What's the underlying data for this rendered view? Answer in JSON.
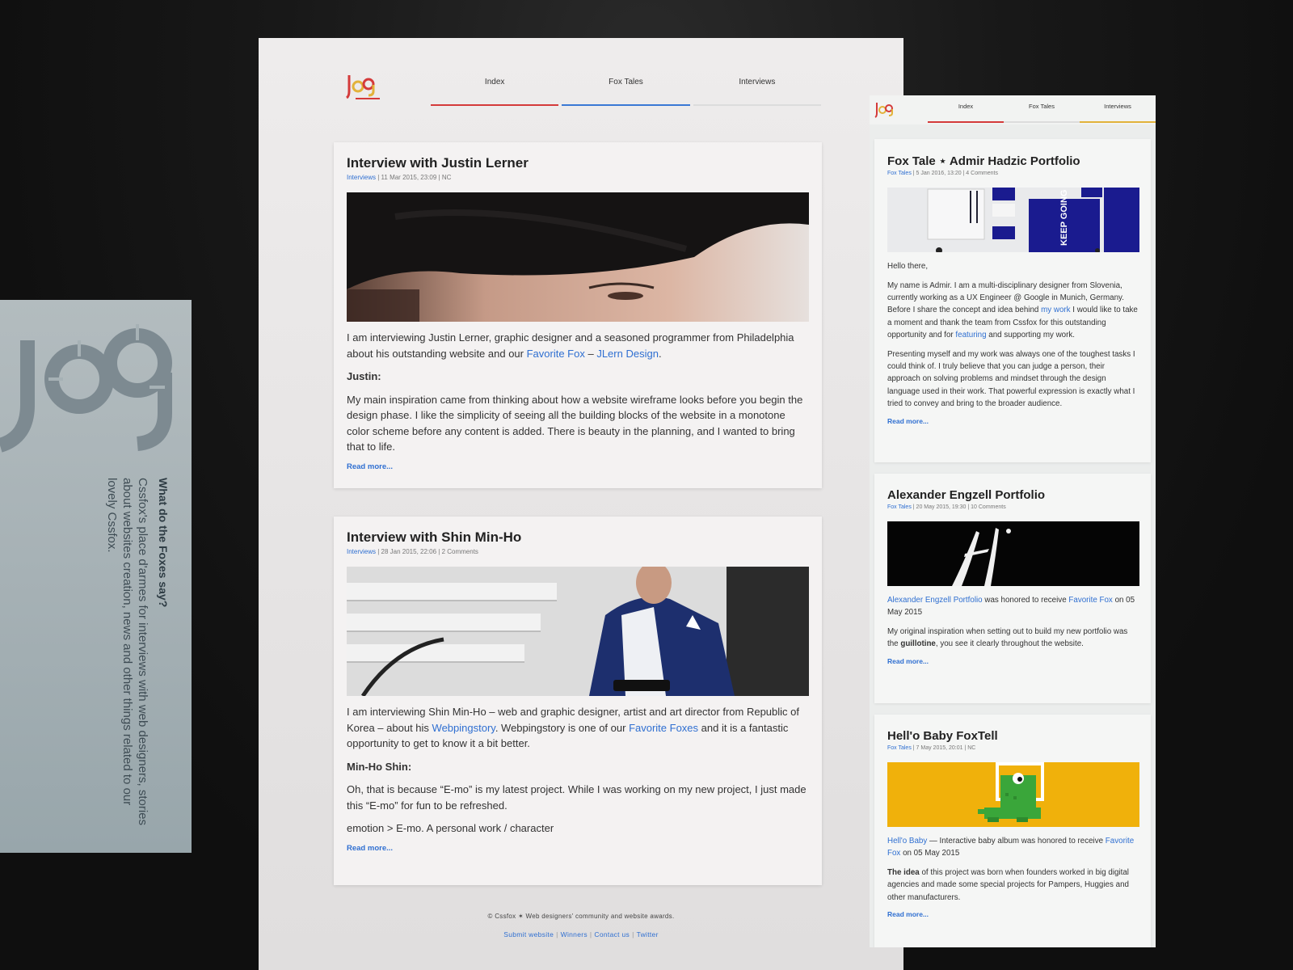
{
  "colors": {
    "accent_blue": "#2f6fd1",
    "nav_red": "#d43a3a",
    "nav_blue": "#3a78d4",
    "nav_yellow": "#e2b23a",
    "background": "#121212"
  },
  "side_panel": {
    "heading": "What do the Foxes say?",
    "text": "Cssfox's place d'armes for interviews with web designers, stories about websites creation, news and other things related to our lovely Cssfox."
  },
  "main": {
    "nav": [
      "Index",
      "Fox Tales",
      "Interviews"
    ],
    "posts": [
      {
        "title": "Interview with Justin Lerner",
        "category": "Interviews",
        "meta": " | 11 Mar 2015, 23:09 | NC",
        "intro_pre": "I am interviewing Justin Lerner, graphic designer and a seasoned programmer from Philadelphia about his outstanding website and our ",
        "link1": "Favorite Fox",
        "dash": " – ",
        "link2": "JLern Design",
        "intro_post": ".",
        "label": "Justin:",
        "body": "My main inspiration came from thinking about how a website wireframe looks before you begin the design phase. I like the simplicity of seeing all the building blocks of the website in a monotone color scheme before any content is added. There is beauty in the planning, and I wanted to bring that to life.",
        "read_more": "Read more..."
      },
      {
        "title": "Interview with Shin Min-Ho",
        "category": "Interviews",
        "meta": " | 28 Jan 2015, 22:06 | 2 Comments",
        "intro_pre": "I am interviewing Shin Min-Ho – web and graphic designer, artist and art director from Republic of Korea – about his ",
        "link1": "Webpingstory",
        "intro_mid": ". Webpingstory is one of our ",
        "link2": "Favorite Foxes",
        "intro_post": " and it is a fantastic opportunity to get to know it a bit better.",
        "label": "Min-Ho Shin:",
        "body": "Oh, that is because “E-mo” is my latest project. While I was working on my new project, I just made this “E-mo” for fun to be refreshed.",
        "body2": "emotion > E-mo. A personal work / character",
        "read_more": "Read more..."
      }
    ],
    "footer": {
      "copyright": "© Cssfox ✶ Web designers' community and website awards.",
      "links": [
        "Submit website",
        "Winners",
        "Contact us",
        "Twitter"
      ]
    }
  },
  "right": {
    "nav": [
      "Index",
      "Fox Tales",
      "Interviews"
    ],
    "posts": [
      {
        "title": "Fox Tale ⋆ Admir Hadzic Portfolio",
        "category": "Fox Tales",
        "meta": " | 5 Jan 2016, 13:20 | 4 Comments",
        "greeting": "Hello there,",
        "p1_pre": "My name is Admir. I am a multi-disciplinary designer from Slovenia, currently working as a UX Engineer @ Google in Munich, Germany. Before I share the concept and idea behind ",
        "p1_link1": "my work",
        "p1_mid": " I would like to take a moment and thank the team from Cssfox for this outstanding opportunity and for ",
        "p1_link2": "featuring",
        "p1_post": " and supporting my work.",
        "p2": "Presenting myself and my work was always one of the toughest tasks I could think of. I truly believe that you can judge a person, their approach on solving problems and mindset through the design language used in their work. That powerful expression is exactly what I tried to convey and bring to the broader audience.",
        "img_text": "KEEP GOING",
        "read_more": "Read more..."
      },
      {
        "title": "Alexander Engzell Portfolio",
        "category": "Fox Tales",
        "meta": " | 20 May 2015, 19:30 | 10 Comments",
        "p1_link1": "Alexander Engzell Portfolio",
        "p1_mid": " was honored to receive ",
        "p1_link2": "Favorite Fox",
        "p1_post": " on 05 May 2015",
        "p2_pre": "My original inspiration when setting out to build my new portfolio was the ",
        "p2_bold": "guillotine",
        "p2_post": ", you see it clearly throughout the website.",
        "read_more": "Read more..."
      },
      {
        "title": "Hell'o Baby FoxTell",
        "category": "Fox Tales",
        "meta": " | 7 May 2015, 20:01 | NC",
        "p1_link1": "Hell'o Baby",
        "p1_mid": " — Interactive baby album was honored to receive ",
        "p1_link2": "Favorite Fox",
        "p1_post": " on 05 May 2015",
        "p2_bold": "The idea",
        "p2_post": " of this project was born when founders worked in big digital agencies and made some special projects for Pampers, Huggies and other manufacturers.",
        "read_more": "Read more..."
      }
    ]
  }
}
